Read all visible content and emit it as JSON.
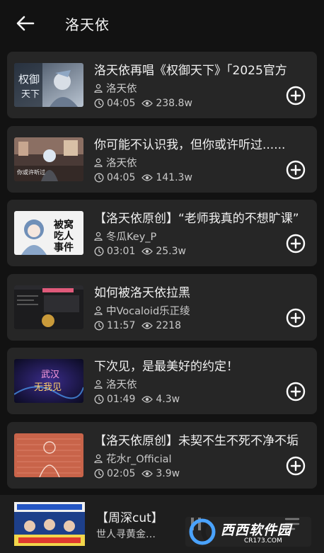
{
  "header": {
    "title": "洛天依"
  },
  "songs": [
    {
      "title": "洛天依再唱《权御天下》「2025官方",
      "author": "洛天依",
      "duration": "04:05",
      "views": "238.8w"
    },
    {
      "title": "你可能不认识我，但你或许听过......",
      "author": "洛天依",
      "duration": "04:05",
      "views": "141.3w"
    },
    {
      "title": "【洛天依原创】“老师我真的不想旷课”",
      "author": "冬瓜Key_P",
      "duration": "03:01",
      "views": "25.3w"
    },
    {
      "title": "如何被洛天依拉黑",
      "author": "中Vocaloid乐正绫",
      "duration": "11:57",
      "views": "2218"
    },
    {
      "title": "下次见，是最美好的约定！",
      "author": "洛天依",
      "duration": "01:49",
      "views": "4.3w"
    },
    {
      "title": "【洛天依原创】未契不生不死不净不垢",
      "author": "花水r_Official",
      "duration": "02:05",
      "views": "3.9w"
    }
  ],
  "player": {
    "title": "【周深cut】",
    "subtitle": "世人寻黄金一世"
  },
  "watermark": {
    "brand": "西西软件园",
    "url": "CR173.COM"
  },
  "colors": {
    "background": "#121212",
    "card": "#262626",
    "player": "#1e1e1e",
    "text": "#f0f0f0",
    "muted": "#c9c9c9"
  }
}
